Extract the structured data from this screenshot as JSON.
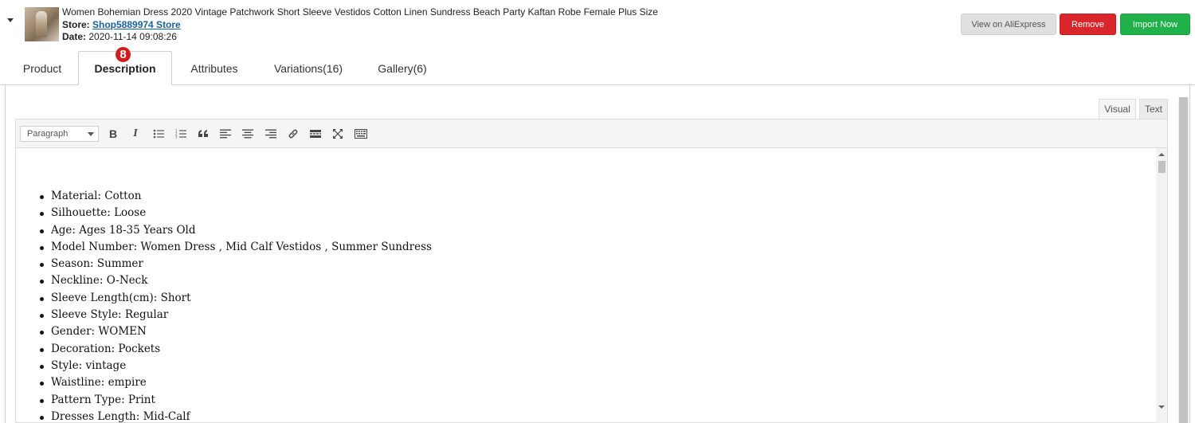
{
  "product": {
    "title": "Women Bohemian Dress 2020 Vintage Patchwork Short Sleeve Vestidos Cotton Linen Sundress Beach Party Kaftan Robe Female Plus Size",
    "store_label": "Store:",
    "store_name": "Shop5889974 Store",
    "date_label": "Date:",
    "date_value": "2020-11-14 09:08:26"
  },
  "actions": {
    "view_label": "View on AliExpress",
    "remove_label": "Remove",
    "import_label": "Import Now"
  },
  "tabs": [
    {
      "label": "Product",
      "active": false
    },
    {
      "label": "Description",
      "active": true
    },
    {
      "label": "Attributes",
      "active": false
    },
    {
      "label": "Variations(16)",
      "active": false
    },
    {
      "label": "Gallery(6)",
      "active": false
    }
  ],
  "step_badge": "8",
  "editor": {
    "modes": {
      "visual": "Visual",
      "text": "Text"
    },
    "active_mode": "Visual",
    "format_value": "Paragraph",
    "toolbar_icons": [
      "bold-icon",
      "italic-icon",
      "bulleted-list-icon",
      "numbered-list-icon",
      "blockquote-icon",
      "align-left-icon",
      "align-center-icon",
      "align-right-icon",
      "link-icon",
      "read-more-icon",
      "fullscreen-icon",
      "toolbar-toggle-icon"
    ],
    "toolbar_text": {
      "bold": "B",
      "italic": "I"
    },
    "content_items": [
      "Material: Cotton",
      "Silhouette: Loose",
      "Age: Ages 18-35 Years Old",
      "Model Number: Women Dress , Mid Calf Vestidos , Summer Sundress",
      "Season: Summer",
      "Neckline: O-Neck",
      "Sleeve Length(cm): Short",
      "Sleeve Style: Regular",
      "Gender: WOMEN",
      "Decoration: Pockets",
      "Style: vintage",
      "Waistline: empire",
      "Pattern Type: Print",
      "Dresses Length: Mid-Calf"
    ]
  },
  "colors": {
    "remove": "#d9262b",
    "import": "#21b14a",
    "badge": "#d11d1d",
    "link": "#1a5f9e"
  }
}
